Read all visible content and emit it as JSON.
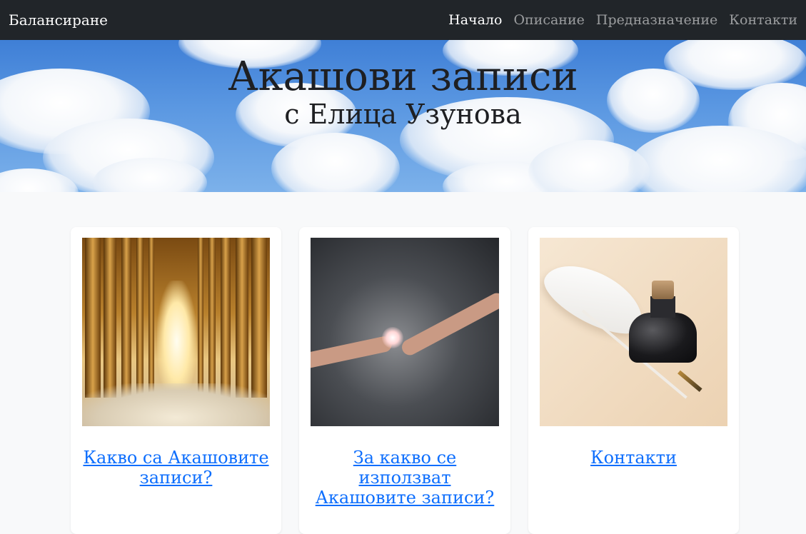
{
  "navbar": {
    "brand": "Балансиране",
    "items": [
      {
        "label": "Начало",
        "active": true
      },
      {
        "label": "Описание",
        "active": false
      },
      {
        "label": "Предназначение",
        "active": false
      },
      {
        "label": "Контакти",
        "active": false
      }
    ]
  },
  "hero": {
    "title": "Акашови записи",
    "subtitle": "с Елица Узунова"
  },
  "cards": [
    {
      "image": "golden-hall-image",
      "link": "Какво са Акашовите записи?"
    },
    {
      "image": "touching-hands-image",
      "link": "За какво се използват Акашовите записи?"
    },
    {
      "image": "quill-and-ink-image",
      "link": "Контакти"
    }
  ],
  "colors": {
    "navbar_bg": "#212529",
    "page_bg": "#f8f9fa",
    "link": "#0d6efd"
  }
}
